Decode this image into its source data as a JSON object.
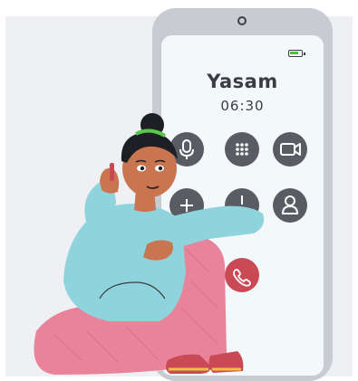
{
  "call": {
    "caller_name": "Yasam",
    "duration": "06:30"
  },
  "buttons": [
    {
      "name": "mute-button",
      "icon": "microphone-icon"
    },
    {
      "name": "keypad-button",
      "icon": "keypad-icon"
    },
    {
      "name": "video-button",
      "icon": "video-camera-icon"
    },
    {
      "name": "add-call-button",
      "icon": "add-icon"
    },
    {
      "name": "speaker-button",
      "icon": "speaker-icon"
    },
    {
      "name": "contacts-button",
      "icon": "contact-person-icon"
    },
    {
      "name": "end-call-button",
      "icon": "phone-hangup-icon"
    }
  ],
  "colors": {
    "phone_frame": "#c8ccd2",
    "screen": "#f3f8fb",
    "button": "#595c63",
    "end_call": "#c94a55",
    "battery": "#4fbd3b",
    "sweater": "#8fd4dc",
    "pants": "#e8839a"
  }
}
